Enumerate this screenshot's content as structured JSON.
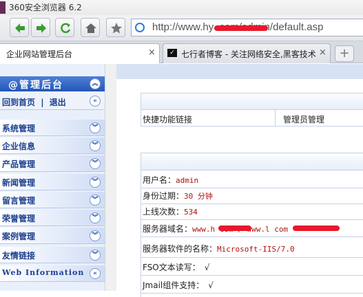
{
  "window": {
    "title": "360安全浏览器 6.2"
  },
  "toolbar": {
    "back_icon": "back-arrow-icon",
    "forward_icon": "forward-arrow-icon",
    "refresh_icon": "refresh-icon",
    "home_icon": "home-icon",
    "favorite_icon": "star-icon"
  },
  "address": {
    "url": "http://www.hy              .com/admin/default.asp"
  },
  "tabs": [
    {
      "label": "企业网站管理后台",
      "close": "×"
    },
    {
      "label": "七行者博客 - 关注网络安全,黑客技术(",
      "close": "×",
      "icon_text": "✓"
    }
  ],
  "new_tab": "+",
  "sidebar": {
    "header": "@管理后台",
    "links": {
      "home": "回到首页",
      "sep": "|",
      "logout": "退出"
    },
    "items": [
      {
        "label": "系统管理"
      },
      {
        "label": "企业信息"
      },
      {
        "label": "产品管理"
      },
      {
        "label": "新闻管理"
      },
      {
        "label": "留言管理"
      },
      {
        "label": "荣誉管理"
      },
      {
        "label": "案例管理"
      },
      {
        "label": "友情链接"
      },
      {
        "label": "Web Information"
      }
    ]
  },
  "quick_panel": {
    "col1": "快捷功能链接",
    "col2": "管理员管理"
  },
  "info_panel": {
    "rows": [
      {
        "label": "用户名：",
        "value": "admin"
      },
      {
        "label": "身份过期：",
        "value": "30 分钟"
      },
      {
        "label": "上线次数：",
        "value": "534"
      },
      {
        "label": "服务器域名：",
        "value": "www.h         com / www.l           com"
      },
      {
        "label": "服务器软件的名称：",
        "value": "Microsoft-IIS/7.0"
      },
      {
        "label": "FSO文本读写：",
        "value": "√"
      },
      {
        "label": "Jmail组件支持：",
        "value": "√"
      }
    ]
  },
  "colors": {
    "accent": "#2456b8",
    "value_text": "#b01010",
    "redact": "#e8182c"
  }
}
